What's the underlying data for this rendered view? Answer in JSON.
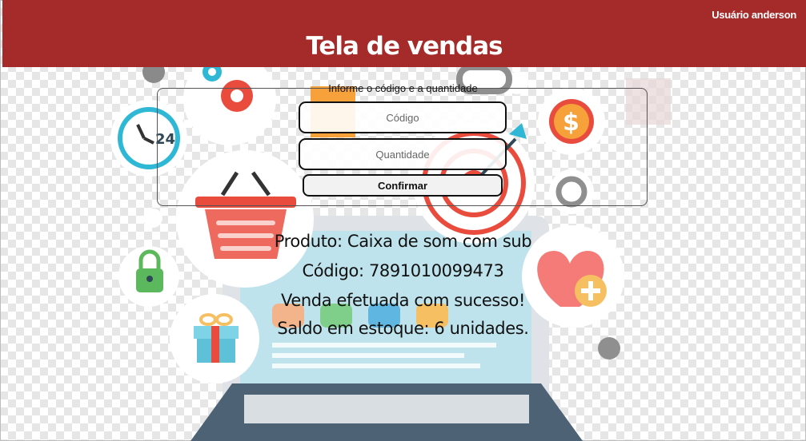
{
  "header": {
    "user_label": "Usuário anderson",
    "title": "Tela de vendas",
    "bg_color": "#a52a2a"
  },
  "form": {
    "label": "Informe o código e a quantidade",
    "codigo_placeholder": "Código",
    "quantidade_placeholder": "Quantidade",
    "confirm_label": "Confirmar"
  },
  "result": {
    "produto": "Produto: Caixa de som com sub",
    "codigo": "Código: 7891010099473",
    "status": "Venda efetuada com sucesso!",
    "saldo": "Saldo em estoque: 6 unidades."
  },
  "icons": [
    "clock-24-icon",
    "gear-icon",
    "shopping-basket-icon",
    "lock-icon",
    "gift-icon",
    "dollar-coin-icon",
    "target-icon",
    "heart-plus-icon",
    "laptop-icon",
    "shopping-bag-icon"
  ]
}
